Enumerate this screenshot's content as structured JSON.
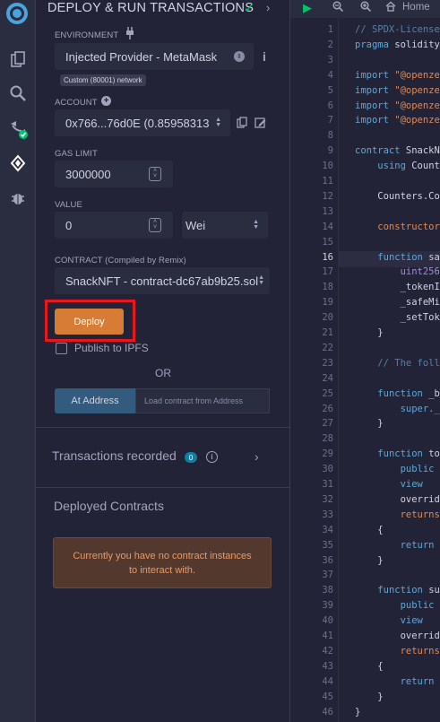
{
  "sidebar_icons": [
    "remix-logo-icon",
    "file-explorer-icon",
    "search-icon",
    "compiler-icon",
    "deploy-icon",
    "debugger-icon"
  ],
  "panel": {
    "title": "DEPLOY & RUN TRANSACTIONS",
    "environment": {
      "label": "ENVIRONMENT",
      "value": "Injected Provider - MetaMask",
      "network_badge": "Custom (80001) network"
    },
    "account": {
      "label": "ACCOUNT",
      "value": "0x766...76d0E (0.85958313"
    },
    "gas_limit": {
      "label": "GAS LIMIT",
      "value": "3000000"
    },
    "value": {
      "label": "VALUE",
      "amount": "0",
      "unit": "Wei"
    },
    "contract": {
      "label": "CONTRACT",
      "label_note": "(Compiled by Remix)",
      "value": "SnackNFT - contract-dc67ab9b25.sol"
    },
    "deploy_label": "Deploy",
    "publish_label": "Publish to IPFS",
    "or_label": "OR",
    "at_address_label": "At Address",
    "at_address_placeholder": "Load contract from Address",
    "transactions": {
      "label": "Transactions recorded",
      "count": "0"
    },
    "deployed": {
      "label": "Deployed Contracts",
      "empty_notice": "Currently you have no contract instances to interact with."
    }
  },
  "editor": {
    "home_tab": "Home",
    "lines": [
      {
        "n": "1",
        "t": "// SPDX-License",
        "c": "comment"
      },
      {
        "n": "2",
        "t": "pragma solidity",
        "c": "kw"
      },
      {
        "n": "3",
        "t": "",
        "c": ""
      },
      {
        "n": "4",
        "t": "import \"@openze",
        "c": "import"
      },
      {
        "n": "5",
        "t": "import \"@openze",
        "c": "import"
      },
      {
        "n": "6",
        "t": "import \"@openze",
        "c": "import"
      },
      {
        "n": "7",
        "t": "import \"@openze",
        "c": "import"
      },
      {
        "n": "8",
        "t": "",
        "c": ""
      },
      {
        "n": "9",
        "t": "contract SnackN",
        "c": "kw"
      },
      {
        "n": "10",
        "t": "    using Counte",
        "c": "kw"
      },
      {
        "n": "11",
        "t": "",
        "c": ""
      },
      {
        "n": "12",
        "t": "    Counters.Co",
        "c": "plain"
      },
      {
        "n": "13",
        "t": "",
        "c": ""
      },
      {
        "n": "14",
        "t": "    constructor",
        "c": "str"
      },
      {
        "n": "15",
        "t": "",
        "c": ""
      },
      {
        "n": "16",
        "t": "    function sa",
        "c": "kw"
      },
      {
        "n": "17",
        "t": "        uint256",
        "c": "type"
      },
      {
        "n": "18",
        "t": "        _tokenI",
        "c": "plain"
      },
      {
        "n": "19",
        "t": "        _safeMi",
        "c": "plain"
      },
      {
        "n": "20",
        "t": "        _setTok",
        "c": "plain"
      },
      {
        "n": "21",
        "t": "    }",
        "c": "plain"
      },
      {
        "n": "22",
        "t": "",
        "c": ""
      },
      {
        "n": "23",
        "t": "    // The foll",
        "c": "comment"
      },
      {
        "n": "24",
        "t": "",
        "c": ""
      },
      {
        "n": "25",
        "t": "    function _b",
        "c": "kw"
      },
      {
        "n": "26",
        "t": "        super._",
        "c": "kw"
      },
      {
        "n": "27",
        "t": "    }",
        "c": "plain"
      },
      {
        "n": "28",
        "t": "",
        "c": ""
      },
      {
        "n": "29",
        "t": "    function to",
        "c": "kw"
      },
      {
        "n": "30",
        "t": "        public",
        "c": "kw"
      },
      {
        "n": "31",
        "t": "        view",
        "c": "kw"
      },
      {
        "n": "32",
        "t": "        overrid",
        "c": "plain"
      },
      {
        "n": "33",
        "t": "        returns",
        "c": "str"
      },
      {
        "n": "34",
        "t": "    {",
        "c": "plain"
      },
      {
        "n": "35",
        "t": "        return",
        "c": "kw"
      },
      {
        "n": "36",
        "t": "    }",
        "c": "plain"
      },
      {
        "n": "37",
        "t": "",
        "c": ""
      },
      {
        "n": "38",
        "t": "    function su",
        "c": "kw"
      },
      {
        "n": "39",
        "t": "        public",
        "c": "kw"
      },
      {
        "n": "40",
        "t": "        view",
        "c": "kw"
      },
      {
        "n": "41",
        "t": "        overrid",
        "c": "plain"
      },
      {
        "n": "42",
        "t": "        returns",
        "c": "str"
      },
      {
        "n": "43",
        "t": "    {",
        "c": "plain"
      },
      {
        "n": "44",
        "t": "        return",
        "c": "kw"
      },
      {
        "n": "45",
        "t": "    }",
        "c": "plain"
      },
      {
        "n": "46",
        "t": "}",
        "c": "plain"
      }
    ],
    "active_line": "16"
  }
}
